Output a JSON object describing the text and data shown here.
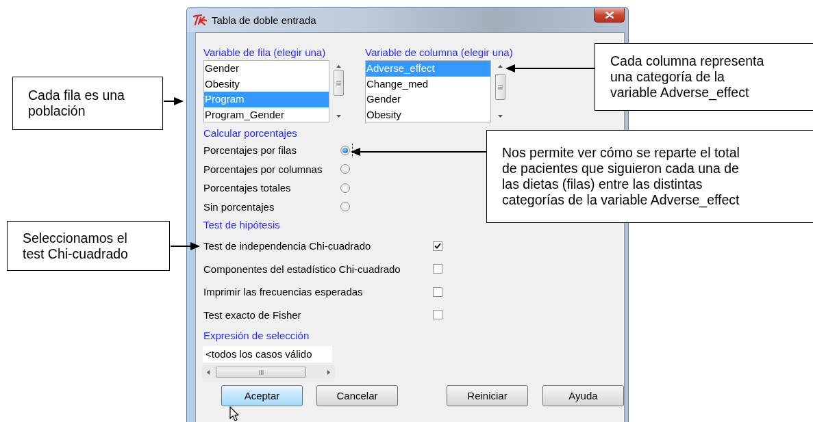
{
  "window": {
    "title": "Tabla de doble entrada"
  },
  "row_variable": {
    "label": "Variable de fila (elegir una)",
    "items": [
      {
        "label": "Gender",
        "selected": false
      },
      {
        "label": "Obesity",
        "selected": false
      },
      {
        "label": "Program",
        "selected": true
      },
      {
        "label": "Program_Gender",
        "selected": false
      }
    ]
  },
  "column_variable": {
    "label": "Variable de columna (elegir una)",
    "items": [
      {
        "label": "Adverse_effect",
        "selected": true
      },
      {
        "label": "Change_med",
        "selected": false
      },
      {
        "label": "Gender",
        "selected": false
      },
      {
        "label": "Obesity",
        "selected": false
      }
    ]
  },
  "percentages": {
    "label": "Calcular porcentajes",
    "options": [
      {
        "label": "Porcentajes por filas",
        "selected": true
      },
      {
        "label": "Porcentajes por columnas",
        "selected": false
      },
      {
        "label": "Porcentajes totales",
        "selected": false
      },
      {
        "label": "Sin porcentajes",
        "selected": false
      }
    ]
  },
  "hypothesis_tests": {
    "label": "Test de hipótesis",
    "options": [
      {
        "label": "Test de independencia Chi-cuadrado",
        "checked": true
      },
      {
        "label": "Componentes del estadístico Chi-cuadrado",
        "checked": false
      },
      {
        "label": "Imprimir las frecuencias esperadas",
        "checked": false
      },
      {
        "label": "Test exacto de Fisher",
        "checked": false
      }
    ]
  },
  "selection_expression": {
    "label": "Expresión de selección",
    "value": "<todos los casos válido"
  },
  "buttons": [
    {
      "label": "Aceptar",
      "selected": true
    },
    {
      "label": "Cancelar",
      "selected": false
    },
    {
      "label": "Reiniciar",
      "selected": false
    },
    {
      "label": "Ayuda",
      "selected": false
    }
  ],
  "annotations": [
    {
      "text": "Cada columna representa\nuna categoría de la\nvariable Adverse_effect"
    },
    {
      "text": "Cada fila es una\npoblación"
    },
    {
      "text": "Nos permite ver cómo se reparte el total\nde pacientes que siguieron cada una de\nlas dietas (filas) entre las distintas\ncategorías de la variable Adverse_effect"
    },
    {
      "text": "Seleccionamos el\ntest Chi-cuadrado"
    }
  ]
}
